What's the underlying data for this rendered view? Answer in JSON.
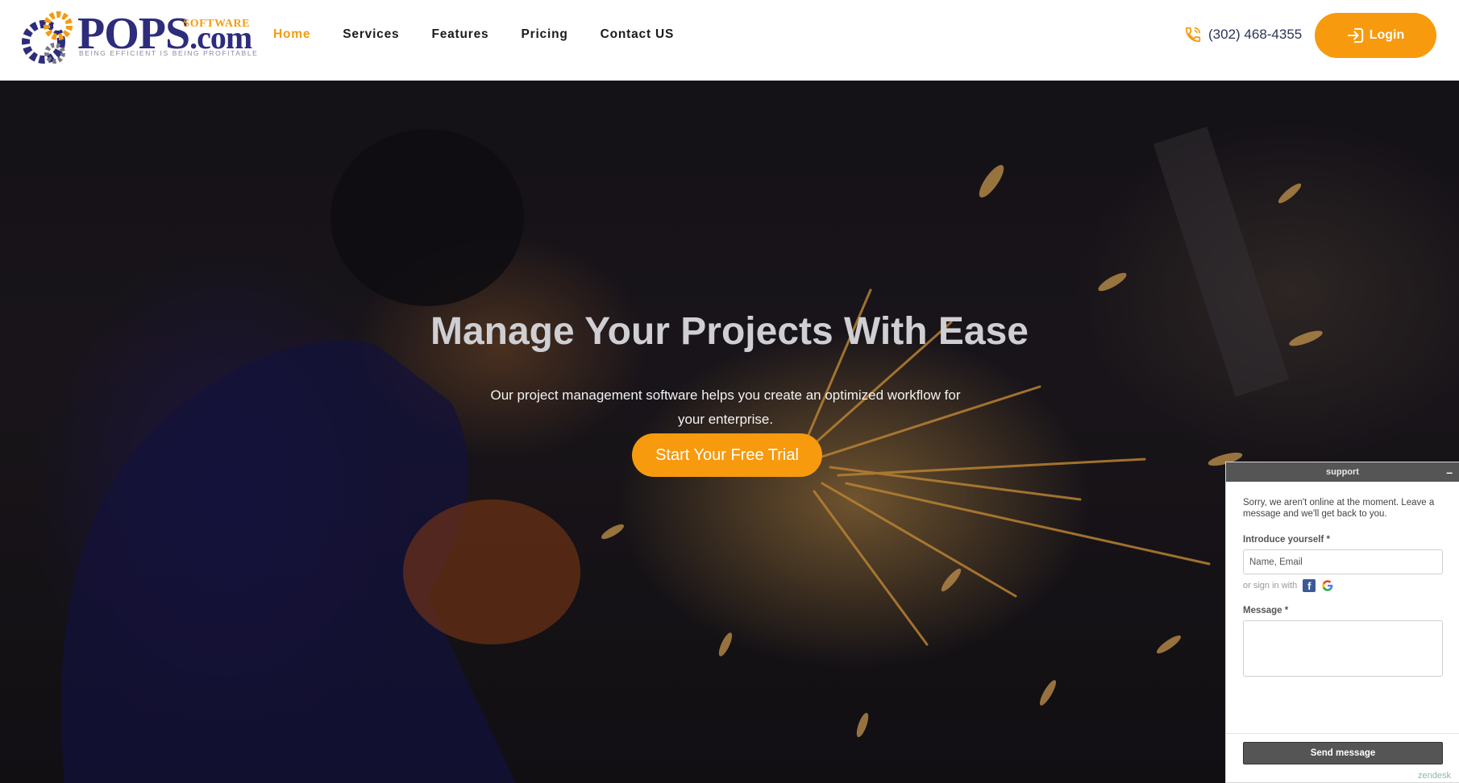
{
  "brand": {
    "name": "POPS",
    "suffix": ".com",
    "software": "SOFTWARE",
    "tagline": "BEING EFFICIENT IS BEING PROFITABLE"
  },
  "nav": {
    "items": [
      {
        "label": "Home",
        "active": true
      },
      {
        "label": "Services",
        "active": false
      },
      {
        "label": "Features",
        "active": false
      },
      {
        "label": "Pricing",
        "active": false
      },
      {
        "label": "Contact US",
        "active": false
      }
    ]
  },
  "header": {
    "phone": "(302) 468-4355",
    "login_label": "Login"
  },
  "hero": {
    "title": "Manage Your Projects With Ease",
    "subtitle": "Our project management software helps you create an optimized workflow for your enterprise.",
    "cta_label": "Start Your Free Trial"
  },
  "chat": {
    "title": "support",
    "minimize": "–",
    "notice": "Sorry, we aren't online at the moment. Leave a message and we'll get back to you.",
    "intro_label": "Introduce yourself *",
    "intro_placeholder": "Name, Email",
    "sign_in_text": "or sign in with",
    "message_label": "Message *",
    "send_label": "Send message",
    "provider": "zendesk"
  },
  "colors": {
    "accent": "#f79a0e",
    "brand_navy": "#2e2c7c",
    "chat_dark": "#555555"
  },
  "icons": {
    "phone": "phone-icon",
    "login": "login-arrow-icon",
    "facebook": "facebook-icon",
    "google": "google-icon"
  }
}
